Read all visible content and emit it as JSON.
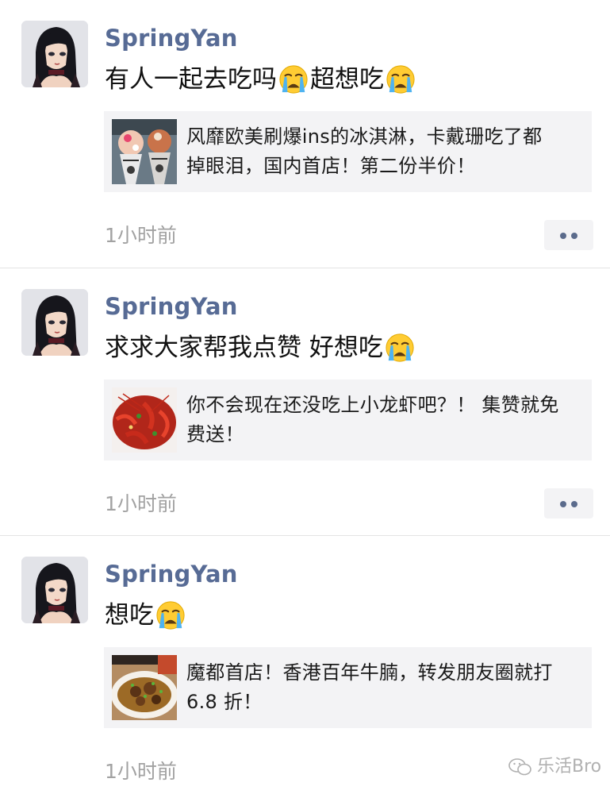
{
  "posts": [
    {
      "author": "SpringYan",
      "text_before": "有人一起去吃吗",
      "text_middle": "超想吃",
      "link_title": "风靡欧美刷爆ins的冰淇淋，卡戴珊吃了都掉眼泪，国内首店！第二份半价！",
      "time": "1小时前"
    },
    {
      "author": "SpringYan",
      "text_before": "求求大家帮我点赞 好想吃",
      "link_title": "你不会现在还没吃上小龙虾吧？！ 集赞就免费送！",
      "time": "1小时前"
    },
    {
      "author": "SpringYan",
      "text_before": "想吃",
      "link_title": "魔都首店！香港百年牛腩，转发朋友圈就打 6.8 折！",
      "time": "1小时前"
    }
  ],
  "icons": {
    "emoji": "crying-face-icon",
    "more": "more-dots-icon",
    "watermark": "wechat-icon"
  },
  "watermark": "乐活Bro",
  "colors": {
    "author_name": "#576b95",
    "time": "#a2a2a2",
    "card_bg": "#f3f3f5"
  }
}
